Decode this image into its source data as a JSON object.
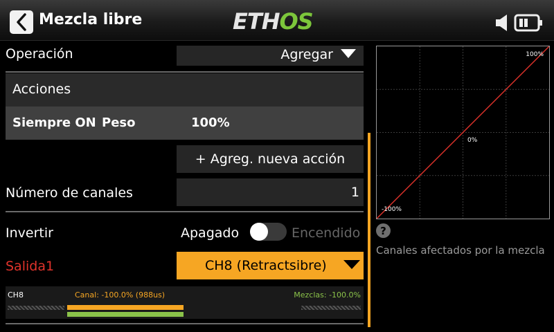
{
  "header": {
    "title": "Mezcla libre",
    "logo_part1": "ETH",
    "logo_part2": "OS",
    "icons": {
      "back": "chevron-left-icon",
      "speaker": "speaker-icon",
      "battery": "battery-icon"
    }
  },
  "form": {
    "operation": {
      "label": "Operación",
      "value": "Agregar"
    },
    "actions": {
      "section_label": "Acciones",
      "row_name": "Siempre ON",
      "row_param_label": "Peso",
      "row_param_value": "100%",
      "add_button": "+ Agreg. nueva acción"
    },
    "channels": {
      "label": "Número de canales",
      "value": "1"
    },
    "invert": {
      "label": "Invertir",
      "off_label": "Apagado",
      "on_label": "Encendido",
      "state": "off"
    },
    "output": {
      "label": "Salida1",
      "value": "CH8 (Retractsibre)"
    }
  },
  "monitor": {
    "channel": "CH8",
    "canal_text": "Canal: -100.0% (988us)",
    "mezclas_text": "Mezclas: -100.0%"
  },
  "curve": {
    "top_label": "100%",
    "center_label": "0%",
    "bottom_label": "-100%",
    "line_points": [
      [
        -100,
        -100
      ],
      [
        100,
        100
      ]
    ]
  },
  "help": {
    "icon": "question-icon",
    "glyph": "?",
    "text": "Canales afectados por la mezcla"
  },
  "colors": {
    "accent": "#f6a623",
    "output_label": "#e0332b",
    "logo_green": "#7cc63b",
    "mezclas_green": "#8bc34a",
    "curve_line": "#e0332b"
  }
}
